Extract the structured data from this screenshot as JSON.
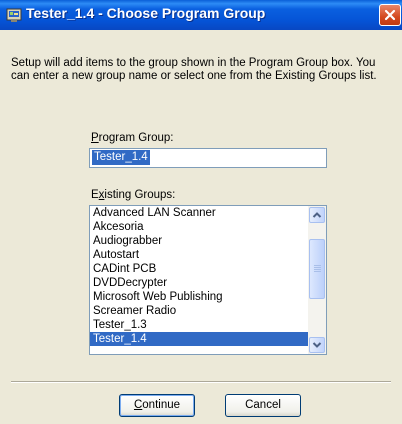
{
  "window": {
    "title": "Tester_1.4 - Choose Program Group"
  },
  "intro_text": "Setup will add items to the group shown in the Program Group box. You can enter a new group name or select one from the Existing Groups list.",
  "program_group": {
    "label_accel": "P",
    "label_rest": "rogram Group:",
    "value": "Tester_1.4"
  },
  "existing_groups": {
    "label_pre": "E",
    "label_accel": "x",
    "label_rest": "isting Groups:",
    "items": [
      "Advanced LAN Scanner",
      "Akcesoria",
      "Audiograbber",
      "Autostart",
      "CADint PCB",
      "DVDDecrypter",
      "Microsoft Web Publishing",
      "Screamer Radio",
      "Tester_1.3",
      "Tester_1.4"
    ],
    "selected": "Tester_1.4"
  },
  "buttons": {
    "continue_accel": "C",
    "continue_rest": "ontinue",
    "cancel": "Cancel"
  },
  "colors": {
    "titlebar": "#0a5fd8",
    "selection": "#316ac5",
    "dialog_bg": "#ece9d8",
    "close_button": "#d4491e"
  },
  "icons": {
    "title": "setup-program-icon",
    "close": "close-icon",
    "scroll_up": "chevron-up-icon",
    "scroll_down": "chevron-down-icon"
  }
}
